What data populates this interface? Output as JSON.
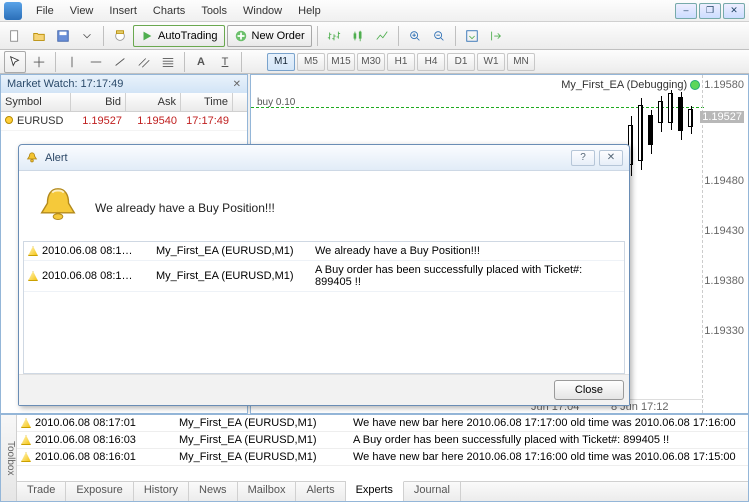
{
  "menu": {
    "file": "File",
    "view": "View",
    "insert": "Insert",
    "charts": "Charts",
    "tools": "Tools",
    "window": "Window",
    "help": "Help"
  },
  "toolbar": {
    "autotrading": "AutoTrading",
    "neworder": "New Order"
  },
  "timeframes": {
    "active": "M1",
    "items": [
      "M1",
      "M5",
      "M15",
      "M30",
      "H1",
      "H4",
      "D1",
      "W1",
      "MN"
    ]
  },
  "market_watch": {
    "title": "Market Watch: 17:17:49",
    "cols": {
      "symbol": "Symbol",
      "bid": "Bid",
      "ask": "Ask",
      "time": "Time"
    },
    "rows": [
      {
        "symbol": "EURUSD",
        "bid": "1.19527",
        "ask": "1.19540",
        "time": "17:17:49",
        "color": "#c02020"
      }
    ]
  },
  "chart": {
    "buy_label": "buy 0.10",
    "ea_label": "My_First_EA (Debugging)",
    "y_ticks": [
      "1.19580",
      "1.19527",
      "1.19480",
      "1.19430",
      "1.19380",
      "1.19330"
    ],
    "y_hl_index": 1,
    "x_ticks": [
      "Jun 17:04",
      "8 Jun 17:12"
    ]
  },
  "alert": {
    "title": "Alert",
    "message": "We already have a Buy Position!!!",
    "close": "Close",
    "rows": [
      {
        "time": "2010.06.08 08:1…",
        "source": "My_First_EA (EURUSD,M1)",
        "msg": "We already have a Buy Position!!!"
      },
      {
        "time": "2010.06.08 08:1…",
        "source": "My_First_EA (EURUSD,M1)",
        "msg": "A Buy order has been successfully placed with Ticket#: 899405 !!"
      }
    ]
  },
  "toolbox": {
    "label": "Toolbox",
    "tabs": [
      "Trade",
      "Exposure",
      "History",
      "News",
      "Mailbox",
      "Alerts",
      "Experts",
      "Journal"
    ],
    "active_tab": "Experts",
    "rows": [
      {
        "time": "2010.06.08 08:17:01",
        "source": "My_First_EA (EURUSD,M1)",
        "msg": "We have new bar here  2010.06.08 17:17:00  old time was  2010.06.08 17:16:00"
      },
      {
        "time": "2010.06.08 08:16:03",
        "source": "My_First_EA (EURUSD,M1)",
        "msg": "A Buy order has been successfully placed with Ticket#: 899405 !!"
      },
      {
        "time": "2010.06.08 08:16:01",
        "source": "My_First_EA (EURUSD,M1)",
        "msg": "We have new bar here  2010.06.08 17:16:00  old time was  2010.06.08 17:15:00"
      }
    ]
  }
}
